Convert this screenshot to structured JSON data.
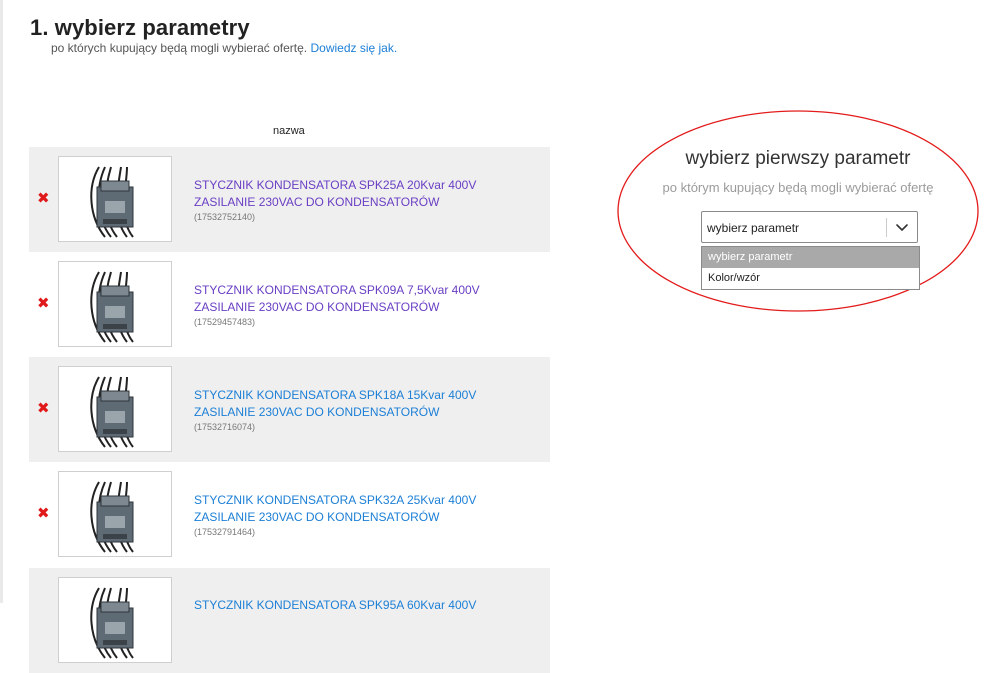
{
  "header": {
    "title": "1. wybierz parametry",
    "subtitle_text": "po których kupujący będą mogli wybierać ofertę.",
    "learn_more_link": "Dowiedz się jak."
  },
  "column_header": "nazwa",
  "products": [
    {
      "title_line1": "STYCZNIK KONDENSATORA SPK25A 20Kvar 400V",
      "title_line2": "ZASILANIE 230VAC DO KONDENSATORÓW",
      "id": "(17532752140)",
      "visited": true
    },
    {
      "title_line1": "STYCZNIK KONDENSATORA SPK09A 7,5Kvar 400V",
      "title_line2": "ZASILANIE 230VAC DO KONDENSATORÓW",
      "id": "(17529457483)",
      "visited": true
    },
    {
      "title_line1": "STYCZNIK KONDENSATORA SPK18A 15Kvar 400V",
      "title_line2": "ZASILANIE 230VAC DO KONDENSATORÓW",
      "id": "(17532716074)",
      "visited": false
    },
    {
      "title_line1": "STYCZNIK KONDENSATORA SPK32A 25Kvar 400V",
      "title_line2": "ZASILANIE 230VAC DO KONDENSATORÓW",
      "id": "(17532791464)",
      "visited": false
    },
    {
      "title_line1": "STYCZNIK KONDENSATORA SPK95A 60Kvar 400V",
      "title_line2": "",
      "id": "",
      "visited": false
    }
  ],
  "parameter_panel": {
    "title": "wybierz pierwszy parametr",
    "subtitle": "po którym kupujący będą mogli wybierać ofertę",
    "select_value": "wybierz parametr",
    "options": [
      "wybierz parametr",
      "Kolor/wzór"
    ],
    "selected_option": "wybierz parametr"
  },
  "colors": {
    "link": "#1c7fd6",
    "visited_link": "#6a3fc4",
    "remove": "#e01a1a",
    "oval": "#e31b1b",
    "row_shade": "#efefef"
  },
  "icons": {
    "remove": "cross-icon",
    "select_arrow": "chevron-down-icon"
  }
}
